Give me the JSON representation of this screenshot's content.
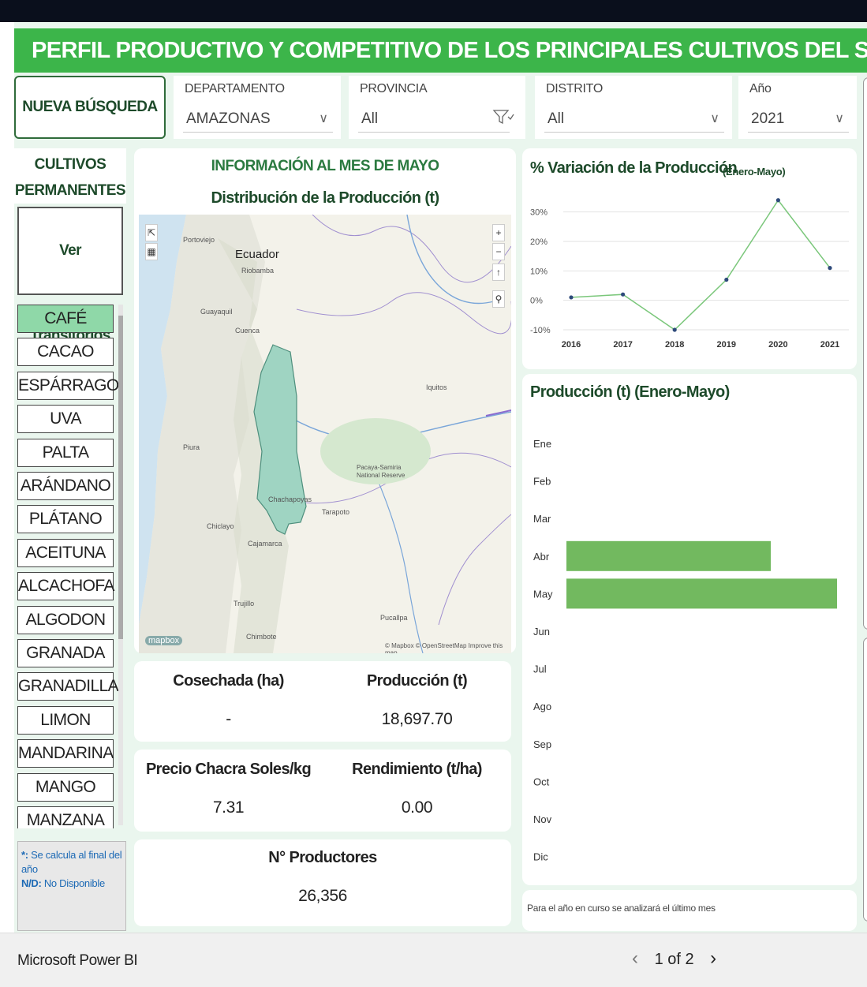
{
  "header": {
    "title": "PERFIL PRODUCTIVO Y COMPETITIVO DE LOS PRINCIPALES CULTIVOS DEL SECTOR"
  },
  "new_search_button": "NUEVA BÚSQUEDA",
  "filters": [
    {
      "label": "DEPARTAMENTO",
      "value": "AMAZONAS"
    },
    {
      "label": "PROVINCIA",
      "value": "All"
    },
    {
      "label": "DISTRITO",
      "value": "All"
    },
    {
      "label": "Año",
      "value": "2021"
    }
  ],
  "sidebar": {
    "heading_line1": "CULTIVOS",
    "heading_line2": "PERMANENTES",
    "toggle_button": "Ver Transitorios",
    "crops": [
      "CAFÉ",
      "CACAO",
      "ESPÁRRAGO",
      "UVA",
      "PALTA",
      "ARÁNDANO",
      "PLÁTANO",
      "ACEITUNA",
      "ALCACHOFA",
      "ALGODON",
      "GRANADA",
      "GRANADILLA",
      "LIMON",
      "MANDARINA",
      "MANGO",
      "MANZANA"
    ],
    "selected_crop": "CAFÉ",
    "note": {
      "k1": "*:",
      "v1": "Se calcula al final del año",
      "k2": "N/D:",
      "v2": "No Disponible"
    }
  },
  "main": {
    "info_title": "INFORMACIÓN AL MES DE MAYO",
    "map_title": "Distribución de la Producción (t)",
    "map_labels": {
      "ecuador": "Ecuador",
      "portoviejo": "Portoviejo",
      "riobamba": "Riobamba",
      "guayaquil": "Guayaquil",
      "cuenca": "Cuenca",
      "piura": "Piura",
      "chachapoyas": "Chachapoyas",
      "tarapoto": "Tarapoto",
      "chiclayo": "Chiclayo",
      "cajamarca": "Cajamarca",
      "trujillo": "Trujillo",
      "chimbote": "Chimbote",
      "iquitos": "Iquitos",
      "pucallpa": "Pucallpa",
      "pacaya1": "Pacaya-Samiria",
      "pacaya2": "National Reserve",
      "logo": "mapbox",
      "attribution": "© Mapbox © OpenStreetMap Improve this map"
    },
    "map_fill_color": "#9fd4c2",
    "kpis": {
      "cosechada": {
        "label": "Cosechada (ha)",
        "value": "-"
      },
      "produccion": {
        "label": "Producción (t)",
        "value": "18,697.70"
      },
      "precio": {
        "label": "Precio Chacra Soles/kg",
        "value": "7.31"
      },
      "rendimiento": {
        "label": "Rendimiento (t/ha)",
        "value": "0.00"
      },
      "productores": {
        "label": "N° Productores",
        "value": "26,356"
      }
    }
  },
  "variation_chart": {
    "title": "% Variación de la Producción",
    "subtitle": "(Enero-Mayo)",
    "line_color": "#7bc77b",
    "point_color": "#2e4a7a"
  },
  "production_chart": {
    "title": "Producción (t) (Enero-Mayo)",
    "bar_color": "#72b95f"
  },
  "footer_note": "Para el año en curso se analizará el último mes",
  "chart_data": [
    {
      "type": "line",
      "x": [
        "2016",
        "2017",
        "2018",
        "2019",
        "2020",
        "2021"
      ],
      "series": [
        {
          "values": [
            1,
            2,
            -10,
            7,
            34,
            11
          ]
        }
      ],
      "ylim": [
        -10,
        35
      ],
      "yticks": [
        "30%",
        "20%",
        "10%",
        "0%",
        "-10%"
      ],
      "ytick_values": [
        30,
        20,
        10,
        0,
        -10
      ],
      "grid": true
    },
    {
      "type": "bar",
      "orientation": "horizontal",
      "categories": [
        "Ene",
        "Feb",
        "Mar",
        "Abr",
        "May",
        "Jun",
        "Jul",
        "Ago",
        "Sep",
        "Oct",
        "Nov",
        "Dic"
      ],
      "values": [
        0,
        0,
        0,
        7400,
        9800,
        0,
        0,
        0,
        0,
        0,
        0,
        0
      ],
      "xlim": [
        0,
        10000
      ]
    }
  ],
  "bottom_bar": {
    "app_name": "Microsoft Power BI",
    "page_indicator": "1 of 2",
    "prev_arrow": "‹",
    "next_arrow": "›"
  }
}
